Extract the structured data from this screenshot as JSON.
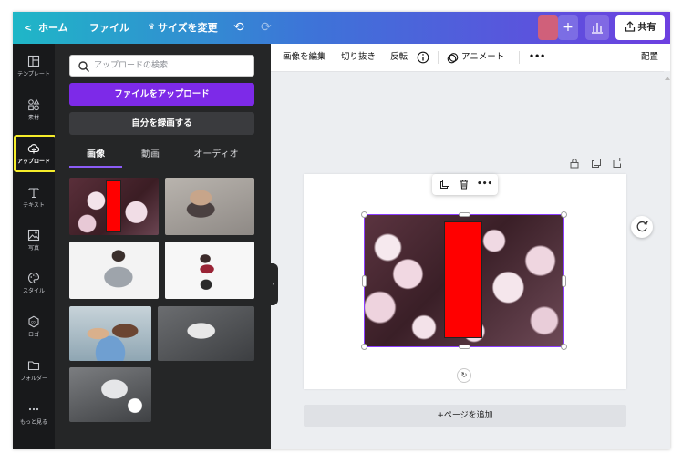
{
  "topbar": {
    "back_label": "ホーム",
    "file_label": "ファイル",
    "resize_label": "サイズを変更",
    "share_label": "共有",
    "resize_icon": "crown-icon",
    "undo_icon": "undo-icon",
    "redo_icon": "redo-icon",
    "stats_icon": "bar-chart-icon",
    "add_icon": "plus-icon",
    "share_icon": "upload-share-icon"
  },
  "rail": {
    "items": [
      {
        "label": "テンプレート",
        "icon": "template-icon"
      },
      {
        "label": "素材",
        "icon": "elements-icon"
      },
      {
        "label": "アップロード",
        "icon": "cloud-upload-icon"
      },
      {
        "label": "テキスト",
        "icon": "text-icon"
      },
      {
        "label": "写真",
        "icon": "photo-icon"
      },
      {
        "label": "スタイル",
        "icon": "palette-icon"
      },
      {
        "label": "ロゴ",
        "icon": "logo-icon"
      },
      {
        "label": "フォルダー",
        "icon": "folder-icon"
      },
      {
        "label": "もっと見る",
        "icon": "more-dots-icon"
      }
    ],
    "active_index": 2
  },
  "panel": {
    "search_placeholder": "アップロードの検索",
    "upload_button": "ファイルをアップロード",
    "record_button": "自分を録画する",
    "tabs": [
      "画像",
      "動画",
      "オーディオ"
    ],
    "active_tab": 0
  },
  "editor_toolbar": {
    "edit_image": "画像を編集",
    "crop": "切り抜き",
    "flip": "反転",
    "animate": "アニメート",
    "more": "•••",
    "position": "配置"
  },
  "canvas": {
    "add_page": "+ページを追加",
    "popup_more": "•••"
  },
  "colors": {
    "accent": "#7d2ae8",
    "highlight": "#f5ec2a",
    "redact": "#ff0000",
    "selection": "#8b3dff"
  }
}
